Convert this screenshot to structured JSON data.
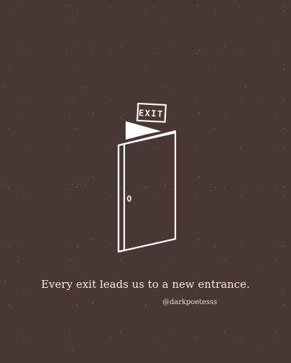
{
  "illustration": {
    "sign_text": "EXIT",
    "icon": "door-icon"
  },
  "quote": "Every exit leads us to a new entrance.",
  "handle": "@darkpoetesss",
  "colors": {
    "background": "#4a3634",
    "ink": "#ffffff"
  }
}
